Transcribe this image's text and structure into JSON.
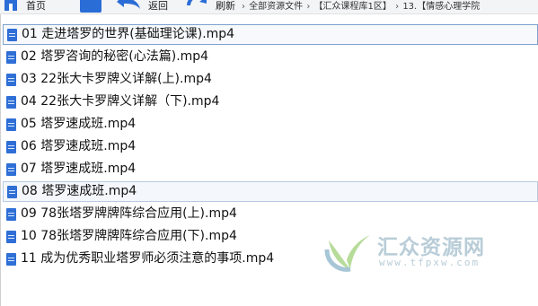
{
  "toolbar": {
    "home_label": "首页",
    "back_label": "返回",
    "refresh_label": "刷新",
    "breadcrumbs": [
      "全部资源文件",
      "【汇众课程库1区】",
      "13.【情感心理学院"
    ]
  },
  "files": [
    {
      "name": "01 走进塔罗的世界(基础理论课).mp4",
      "state": "selected"
    },
    {
      "name": "02 塔罗咨询的秘密(心法篇).mp4",
      "state": "normal"
    },
    {
      "name": "03 22张大卡罗牌义详解(上).mp4",
      "state": "normal"
    },
    {
      "name": "04 22张大卡罗牌义详解（下).mp4",
      "state": "normal"
    },
    {
      "name": "05 塔罗速成班.mp4",
      "state": "normal"
    },
    {
      "name": "06 塔罗速成班.mp4",
      "state": "normal"
    },
    {
      "name": "07 塔罗速成班.mp4",
      "state": "normal"
    },
    {
      "name": "08 塔罗速成班.mp4",
      "state": "hover"
    },
    {
      "name": "09 78张塔罗牌牌阵综合应用(上).mp4",
      "state": "normal"
    },
    {
      "name": "10 78张塔罗牌牌阵综合应用(下).mp4",
      "state": "normal"
    },
    {
      "name": "11 成为优秀职业塔罗师必须注意的事项.mp4",
      "state": "normal"
    }
  ],
  "watermark": {
    "title": "汇众资源网",
    "url": "www.tfpxw.com"
  },
  "colors": {
    "accent": "#2f6fd6",
    "selected_border": "#7da2ce",
    "watermark": "#b9cdd8"
  }
}
